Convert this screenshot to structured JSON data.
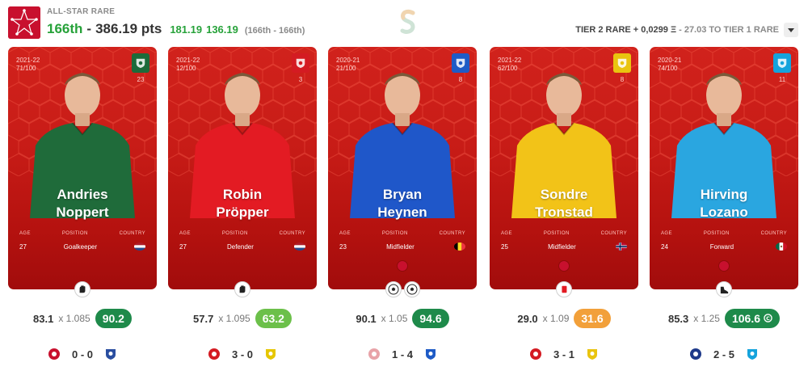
{
  "header": {
    "league_name": "ALL-STAR RARE",
    "rank": "166th",
    "separator": "-",
    "points": "386.19 pts",
    "score_a": "181.19",
    "score_b": "136.19",
    "rank_range": "(166th - 166th)",
    "tier_text": "TIER 2 RARE + 0,0299 Ξ",
    "tier_next": " - 27.03 TO TIER 1 RARE",
    "dropdown_icon": "chevron-down-icon"
  },
  "labels": {
    "age": "AGE",
    "position": "POSITION",
    "country": "COUNTRY"
  },
  "cards": [
    {
      "season": "2021-22",
      "serial": "71/100",
      "jersey": "23",
      "first": "Andries",
      "last": "Noppert",
      "age": "27",
      "position": "Goalkeeper",
      "country_icon": "netherlands-flag-icon",
      "shirt": "#1f6b3a",
      "badge_color": "#1d6b3a",
      "below_icons": [
        "glove-icon"
      ],
      "base": "83.1",
      "mult": "x 1.085",
      "total": "90.2",
      "pill_color": "#1e8a4a",
      "home": "feyenoord-icon",
      "score": "0 - 0",
      "away": "heerenveen-icon",
      "home_color": "#c8102e",
      "away_color": "#2a4ea0"
    },
    {
      "season": "2021-22",
      "serial": "12/100",
      "jersey": "3",
      "first": "Robin",
      "last": "Pröpper",
      "age": "27",
      "position": "Defender",
      "country_icon": "netherlands-flag-icon",
      "shirt": "#e31b23",
      "badge_color": "#d41b22",
      "below_icons": [
        "glove-icon"
      ],
      "base": "57.7",
      "mult": "x 1.095",
      "total": "63.2",
      "pill_color": "#6cc04a",
      "home": "twente-icon",
      "score": "3 - 0",
      "away": "sittard-icon",
      "home_color": "#d41b22",
      "away_color": "#e6c600"
    },
    {
      "season": "2020-21",
      "serial": "21/100",
      "jersey": "8",
      "first": "Bryan",
      "last": "Heynen",
      "age": "23",
      "position": "Midfielder",
      "country_icon": "belgium-flag-icon",
      "shirt": "#1f57c9",
      "badge_color": "#1e5bc6",
      "below_icons": [
        "soccer-ball-icon",
        "soccer-ball-icon"
      ],
      "base": "90.1",
      "mult": "x 1.05",
      "total": "94.6",
      "pill_color": "#1e8a4a",
      "home": "zulte-waregem-icon",
      "score": "1 - 4",
      "away": "genk-icon",
      "home_color": "#e8a3a8",
      "away_color": "#1e5bc6"
    },
    {
      "season": "2021-22",
      "serial": "62/100",
      "jersey": "8",
      "first": "Sondre",
      "last": "Tronstad",
      "age": "25",
      "position": "Midfielder",
      "country_icon": "norway-flag-icon",
      "shirt": "#f2c318",
      "badge_color": "#e9c40f",
      "below_icons": [
        "red-card-icon"
      ],
      "base": "29.0",
      "mult": "x 1.09",
      "total": "31.6",
      "pill_color": "#f2a03a",
      "home": "psv-icon",
      "score": "3 - 1",
      "away": "vitesse-icon",
      "home_color": "#d41b22",
      "away_color": "#e9c40f"
    },
    {
      "season": "2020-21",
      "serial": "74/100",
      "jersey": "11",
      "first": "Hirving",
      "last": "Lozano",
      "age": "24",
      "position": "Forward",
      "country_icon": "mexico-flag-icon",
      "shirt": "#2aa6e0",
      "badge_color": "#15a3dc",
      "below_icons": [
        "boot-icon"
      ],
      "base": "85.3",
      "mult": "x 1.25",
      "total": "106.6",
      "pill_color": "#1e8a4a",
      "pill_icon": "captain-icon",
      "home": "hellas-verona-icon",
      "score": "2 - 5",
      "away": "napoli-icon",
      "home_color": "#1e3a8a",
      "away_color": "#15a3dc"
    }
  ]
}
